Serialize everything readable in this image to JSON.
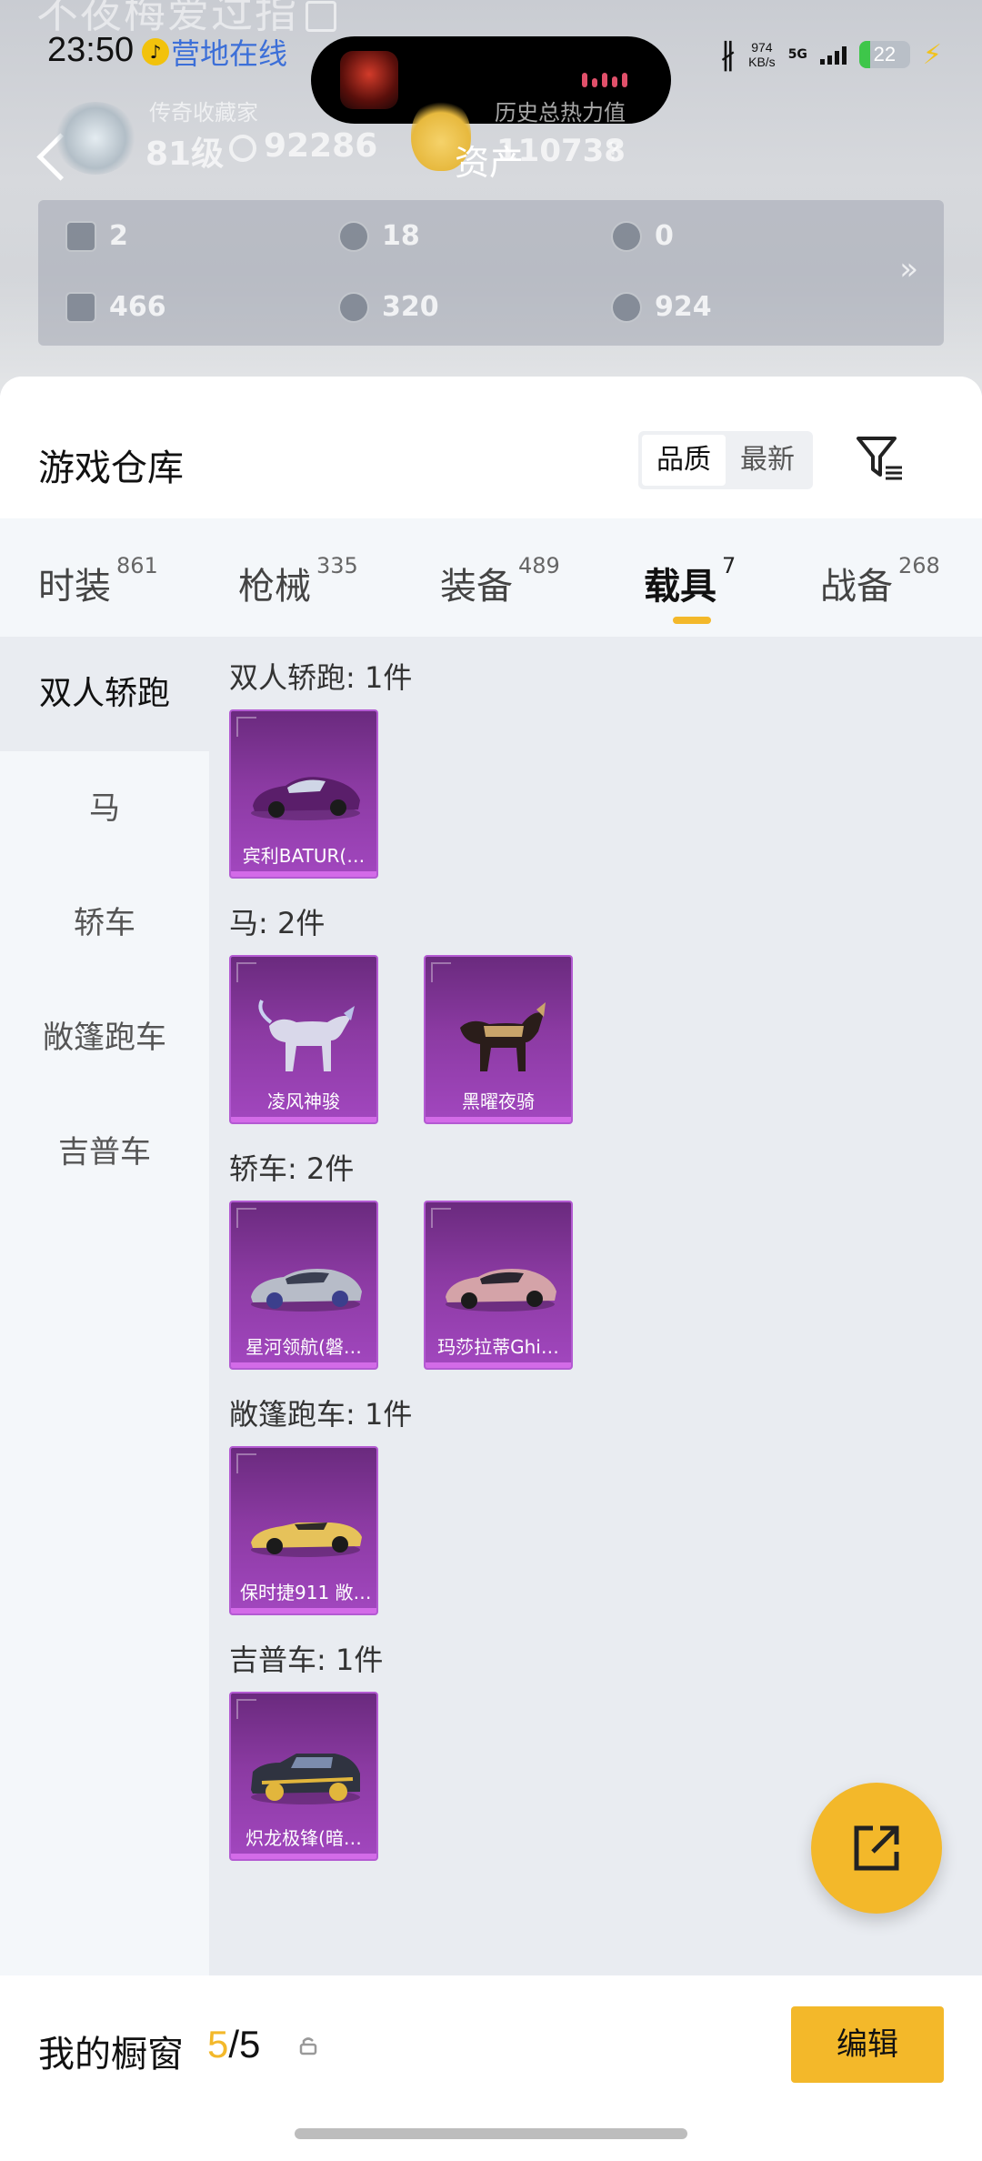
{
  "header": {
    "faded_name": "不夜梅爱过指",
    "time": "23:50",
    "camp_status": "营地在线",
    "net_speed": "974",
    "net_unit": "KB/s",
    "signal": "5G",
    "battery": "22",
    "battery_level": 0.22,
    "back_label": "back",
    "page_title": "资产",
    "collector_title": "传奇收藏家",
    "level": "81级",
    "score": "92286",
    "history_power_label": "历史总热力值",
    "history_power": "110738",
    "help": "?",
    "resources": [
      {
        "icon": "card-icon",
        "value": "2"
      },
      {
        "icon": "coin-icon",
        "value": "18"
      },
      {
        "icon": "medal-icon",
        "value": "0"
      },
      {
        "icon": "ticket-icon",
        "value": "466"
      },
      {
        "icon": "gem-icon",
        "value": "320"
      },
      {
        "icon": "shell-icon",
        "value": "924"
      }
    ],
    "more": "»"
  },
  "sheet": {
    "title": "游戏仓库",
    "sort": [
      {
        "label": "品质"
      },
      {
        "label": "最新"
      }
    ]
  },
  "tabs": [
    {
      "label": "时装",
      "count": "861"
    },
    {
      "label": "枪械",
      "count": "335"
    },
    {
      "label": "装备",
      "count": "489"
    },
    {
      "label": "载具",
      "count": "7"
    },
    {
      "label": "战备",
      "count": "268"
    }
  ],
  "sidebar": [
    {
      "label": "双人轿跑"
    },
    {
      "label": "马"
    },
    {
      "label": "轿车"
    },
    {
      "label": "敞篷跑车"
    },
    {
      "label": "吉普车"
    }
  ],
  "sections": [
    {
      "title": "双人轿跑: 1件",
      "items": [
        {
          "label": "宾利BATUR(…"
        }
      ]
    },
    {
      "title": "马: 2件",
      "items": [
        {
          "label": "凌风神骏"
        },
        {
          "label": "黑曜夜骑"
        }
      ]
    },
    {
      "title": "轿车: 2件",
      "items": [
        {
          "label": "星河领航(磐…"
        },
        {
          "label": "玛莎拉蒂Ghi…"
        }
      ]
    },
    {
      "title": "敞篷跑车: 1件",
      "items": [
        {
          "label": "保时捷911 敞…"
        }
      ]
    },
    {
      "title": "吉普车: 1件",
      "items": [
        {
          "label": "炽龙极锋(暗…"
        }
      ]
    }
  ],
  "showcase": {
    "title": "我的橱窗",
    "used": "5",
    "sep": "/",
    "total": "5",
    "edit": "编辑"
  },
  "colors": {
    "accent": "#f3b82a",
    "card": "#8b3aa2",
    "link": "#3c6fd8"
  }
}
